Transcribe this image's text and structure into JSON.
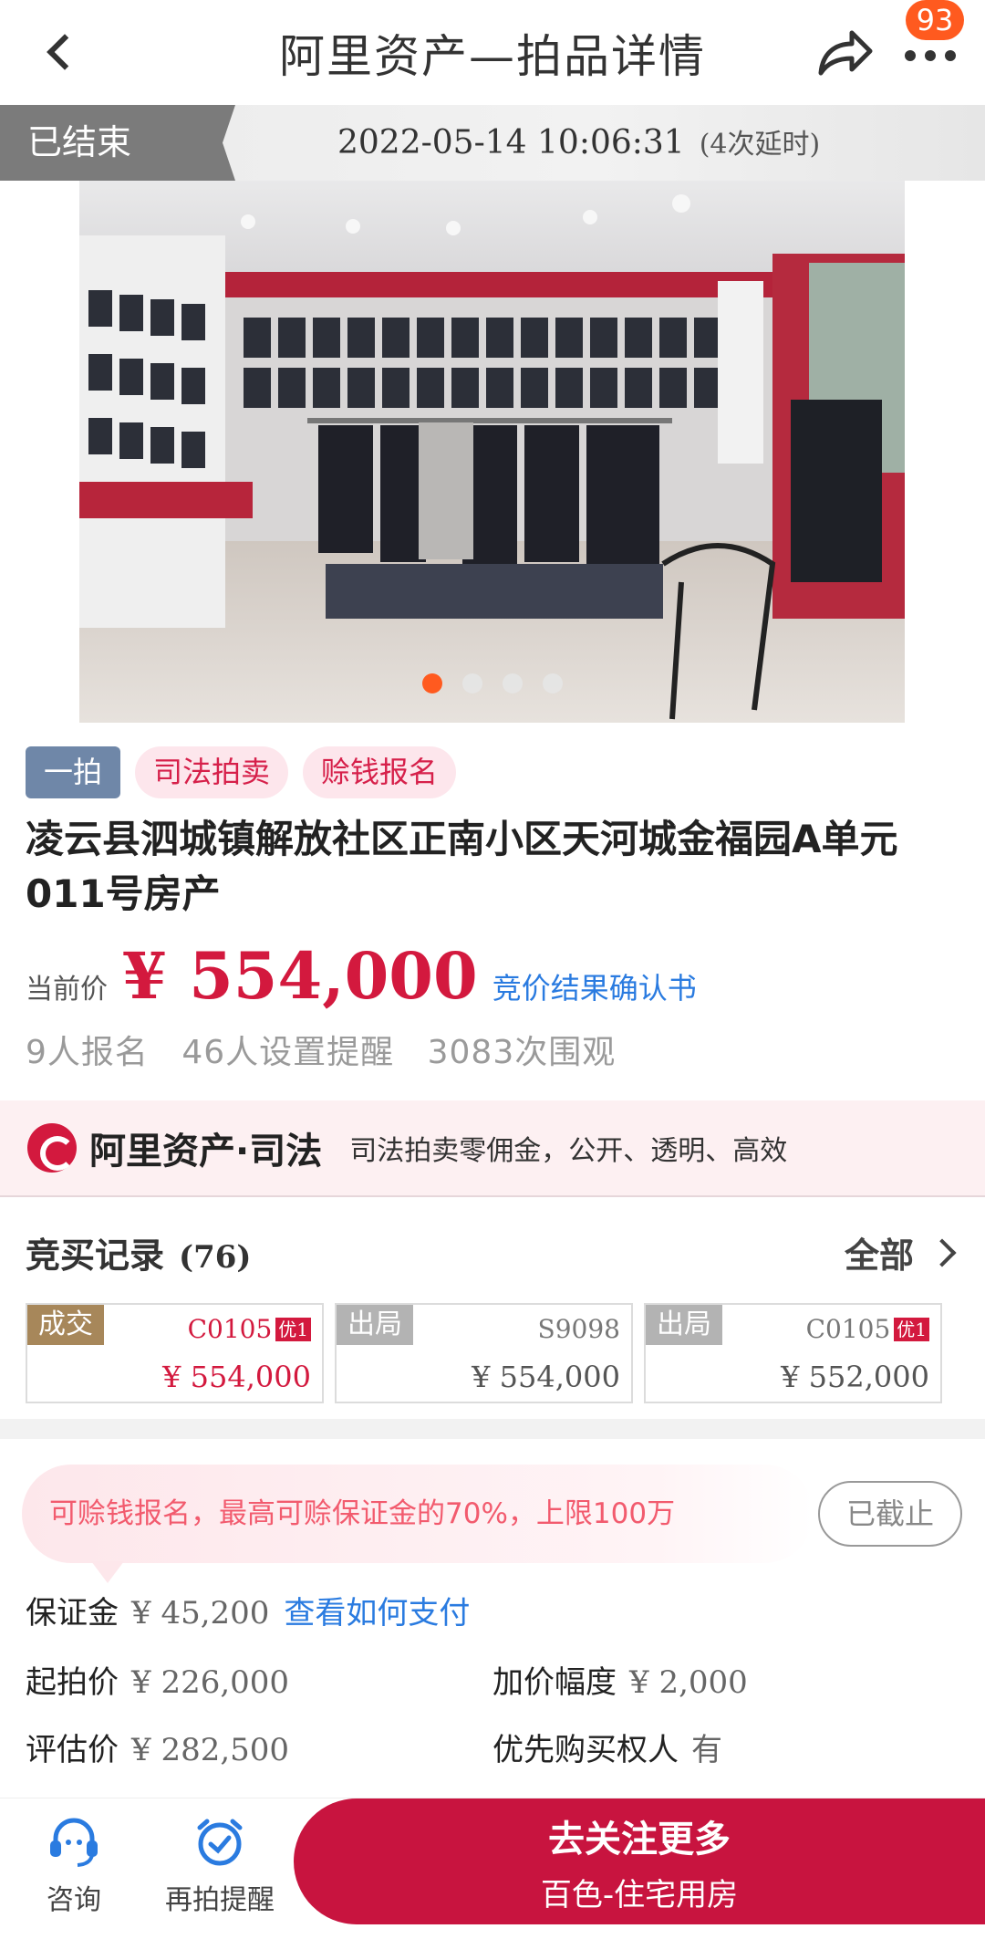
{
  "header": {
    "title": "阿里资产—拍品详情",
    "badge_count": "93"
  },
  "status": {
    "label": "已结束",
    "end_time": "2022-05-14 10:06:31",
    "extension": "(4次延时)"
  },
  "gallery": {
    "image_count": 4,
    "active_index": 0
  },
  "tags": [
    "一拍",
    "司法拍卖",
    "赊钱报名"
  ],
  "item": {
    "title": "凌云县泗城镇解放社区正南小区天河城金福园A单元011号房产",
    "price_label": "当前价",
    "price": "¥ 554,000",
    "confirm_link": "竞价结果确认书",
    "stats": [
      "9人报名",
      "46人设置提醒",
      "3083次围观"
    ]
  },
  "banner": {
    "brand": "阿里资产·司法",
    "text": "司法拍卖零佣金，公开、透明、高效"
  },
  "records": {
    "title": "竞买记录",
    "count": "(76)",
    "all_label": "全部",
    "items": [
      {
        "status": "成交",
        "bidder": "C0105",
        "priority": "优1",
        "price": "¥ 554,000"
      },
      {
        "status": "出局",
        "bidder": "S9098",
        "priority": "",
        "price": "¥ 554,000"
      },
      {
        "status": "出局",
        "bidder": "C0105",
        "priority": "优1",
        "price": "¥ 552,000"
      }
    ]
  },
  "loan": {
    "text": "可赊钱报名，最高可赊保证金的70%，上限100万",
    "button": "已截止"
  },
  "details": {
    "deposit_label": "保证金",
    "deposit_value": "¥ 45,200",
    "deposit_link": "查看如何支付",
    "start_label": "起拍价",
    "start_value": "¥ 226,000",
    "increment_label": "加价幅度",
    "increment_value": "¥ 2,000",
    "appraisal_label": "评估价",
    "appraisal_value": "¥ 282,500",
    "priority_label": "优先购买权人",
    "priority_value": "有"
  },
  "bottom": {
    "consult": "咨询",
    "remind": "再拍提醒",
    "cta_title": "去关注更多",
    "cta_sub": "百色-住宅用房"
  },
  "colors": {
    "accent": "#d3193e",
    "link": "#2a7be0",
    "badge": "#ff5a1f"
  }
}
